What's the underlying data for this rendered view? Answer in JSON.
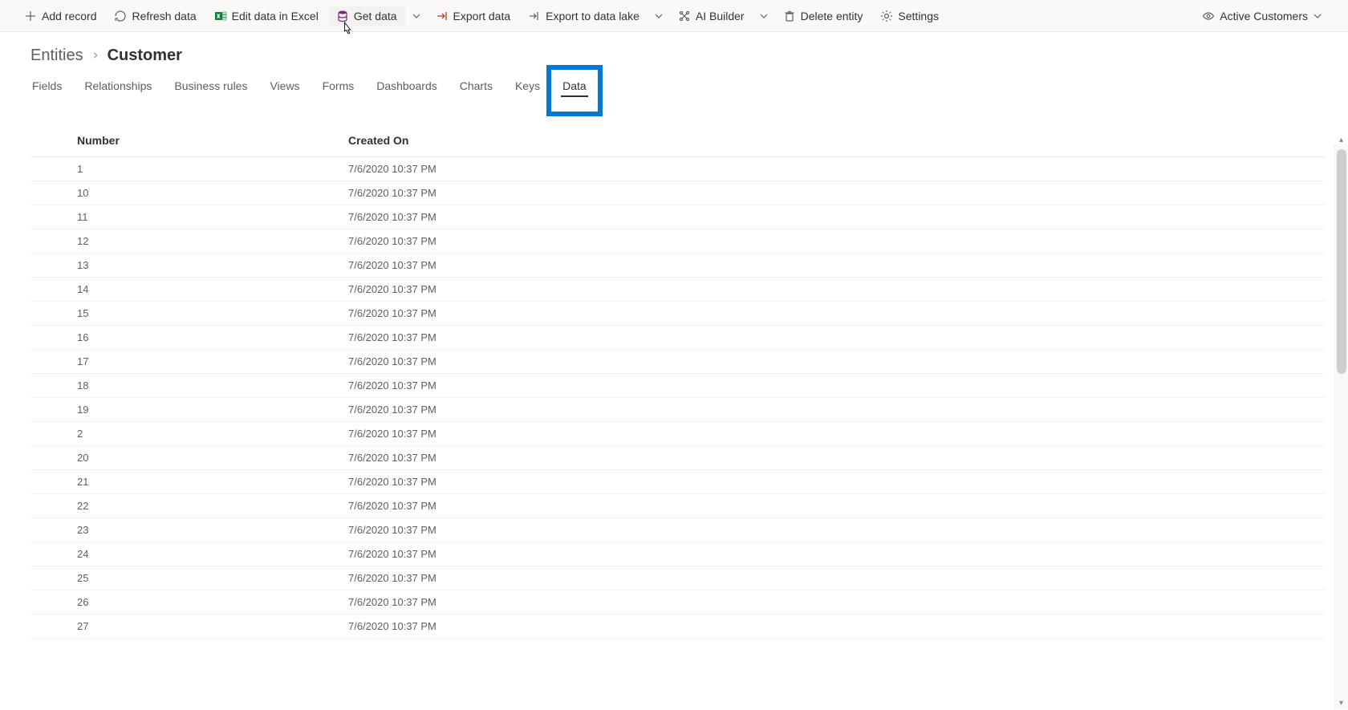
{
  "commands": {
    "add_record": "Add record",
    "refresh_data": "Refresh data",
    "edit_excel": "Edit data in Excel",
    "get_data": "Get data",
    "export_data": "Export data",
    "export_data_lake": "Export to data lake",
    "ai_builder": "AI Builder",
    "delete_entity": "Delete entity",
    "settings": "Settings"
  },
  "view_selector": {
    "label": "Active Customers"
  },
  "icons": {
    "plus": "plus",
    "refresh": "refresh",
    "excel": "excel",
    "database": "database",
    "export": "export",
    "datalake": "export",
    "ai": "ai",
    "trash": "trash",
    "gear": "gear",
    "eye": "eye",
    "chevron_down": "chevron-down",
    "chevron_right": "chevron-right"
  },
  "colors": {
    "get_data_icon": "#742774",
    "excel_icon": "#107c41",
    "export_icon": "#c43e1c",
    "highlight_border": "#0078d4"
  },
  "breadcrumb": {
    "root": "Entities",
    "current": "Customer"
  },
  "tabs": [
    {
      "id": "fields",
      "label": "Fields"
    },
    {
      "id": "relationships",
      "label": "Relationships"
    },
    {
      "id": "business-rules",
      "label": "Business rules"
    },
    {
      "id": "views",
      "label": "Views"
    },
    {
      "id": "forms",
      "label": "Forms"
    },
    {
      "id": "dashboards",
      "label": "Dashboards"
    },
    {
      "id": "charts",
      "label": "Charts"
    },
    {
      "id": "keys",
      "label": "Keys"
    },
    {
      "id": "data",
      "label": "Data"
    }
  ],
  "active_tab": "data",
  "table": {
    "columns": {
      "number": "Number",
      "created_on": "Created On"
    },
    "rows": [
      {
        "number": "1",
        "created_on": "7/6/2020 10:37 PM"
      },
      {
        "number": "10",
        "created_on": "7/6/2020 10:37 PM"
      },
      {
        "number": "11",
        "created_on": "7/6/2020 10:37 PM"
      },
      {
        "number": "12",
        "created_on": "7/6/2020 10:37 PM"
      },
      {
        "number": "13",
        "created_on": "7/6/2020 10:37 PM"
      },
      {
        "number": "14",
        "created_on": "7/6/2020 10:37 PM"
      },
      {
        "number": "15",
        "created_on": "7/6/2020 10:37 PM"
      },
      {
        "number": "16",
        "created_on": "7/6/2020 10:37 PM"
      },
      {
        "number": "17",
        "created_on": "7/6/2020 10:37 PM"
      },
      {
        "number": "18",
        "created_on": "7/6/2020 10:37 PM"
      },
      {
        "number": "19",
        "created_on": "7/6/2020 10:37 PM"
      },
      {
        "number": "2",
        "created_on": "7/6/2020 10:37 PM"
      },
      {
        "number": "20",
        "created_on": "7/6/2020 10:37 PM"
      },
      {
        "number": "21",
        "created_on": "7/6/2020 10:37 PM"
      },
      {
        "number": "22",
        "created_on": "7/6/2020 10:37 PM"
      },
      {
        "number": "23",
        "created_on": "7/6/2020 10:37 PM"
      },
      {
        "number": "24",
        "created_on": "7/6/2020 10:37 PM"
      },
      {
        "number": "25",
        "created_on": "7/6/2020 10:37 PM"
      },
      {
        "number": "26",
        "created_on": "7/6/2020 10:37 PM"
      },
      {
        "number": "27",
        "created_on": "7/6/2020 10:37 PM"
      }
    ]
  }
}
